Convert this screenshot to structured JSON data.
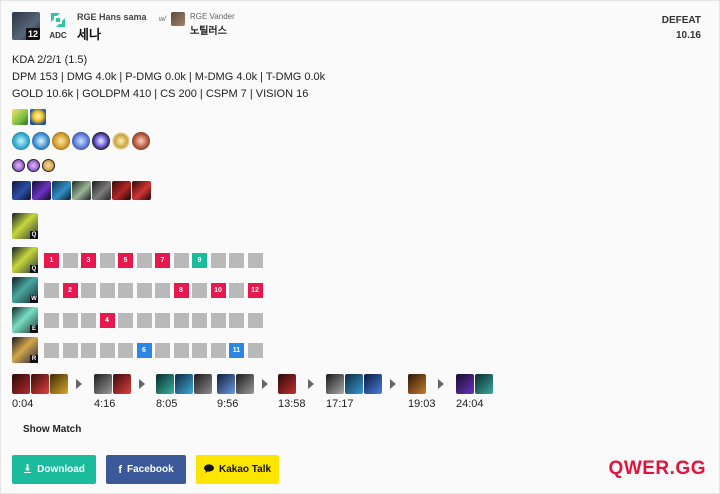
{
  "header": {
    "level": "12",
    "role": "ADC",
    "player_name": "RGE Hans sama",
    "champion": "세나",
    "with_label": "w/",
    "partner_name": "RGE Vander",
    "partner_champion": "노틸러스",
    "result": "DEFEAT",
    "patch": "10.16"
  },
  "stats": {
    "kda": "KDA 2/2/1 (1.5)",
    "damage": "DPM 153 | DMG 4.0k | P-DMG 0.0k | M-DMG 4.0k | T-DMG 0.0k",
    "economy": "GOLD 10.6k | GOLDPM 410 | CS 200 | CSPM 7 | VISION 16"
  },
  "summoner_spells": [
    "heal-spell-icon",
    "flash-spell-icon"
  ],
  "runes": [
    "rune-1-icon",
    "rune-2-icon",
    "rune-3-icon",
    "rune-4-icon",
    "rune-5-icon",
    "rune-6-icon",
    "rune-7-icon"
  ],
  "rune_shards": [
    "shard-1-icon",
    "shard-2-icon",
    "shard-3-icon"
  ],
  "items": [
    "item-1-icon",
    "item-2-icon",
    "item-3-icon",
    "item-4-icon",
    "item-5-icon",
    "item-6-icon",
    "item-7-icon"
  ],
  "first_skill_key": "Q",
  "skill_order": [
    {
      "key": "Q",
      "cells": [
        "1",
        "",
        "3",
        "",
        "5",
        "",
        "7",
        "",
        "9",
        "",
        "",
        ""
      ]
    },
    {
      "key": "W",
      "cells": [
        "",
        "2",
        "",
        "",
        "",
        "",
        "",
        "8",
        "",
        "10",
        "",
        "12"
      ]
    },
    {
      "key": "E",
      "cells": [
        "",
        "",
        "",
        "4",
        "",
        "",
        "",
        "",
        "",
        "",
        "",
        ""
      ]
    },
    {
      "key": "R",
      "cells": [
        "",
        "",
        "",
        "",
        "",
        "6",
        "",
        "",
        "",
        "",
        "11",
        ""
      ]
    }
  ],
  "colors": {
    "cell_default": "#b9b9b9",
    "cell_basic": "#e8184f",
    "cell_ult": "#2c86e6",
    "cell_max": "#1abc9c",
    "brand": "#e8113c"
  },
  "build_order": [
    {
      "time": "0:04",
      "items": 3
    },
    {
      "time": "4:16",
      "items": 2
    },
    {
      "time": "8:05",
      "items": 3
    },
    {
      "time": "9:56",
      "items": 2
    },
    {
      "time": "13:58",
      "items": 1
    },
    {
      "time": "17:17",
      "items": 3
    },
    {
      "time": "19:03",
      "items": 1
    },
    {
      "time": "24:04",
      "items": 2
    }
  ],
  "actions": {
    "show_match": "Show Match",
    "download": "Download",
    "facebook": "Facebook",
    "kakao": "Kakao Talk"
  },
  "brand": "QWER.GG"
}
